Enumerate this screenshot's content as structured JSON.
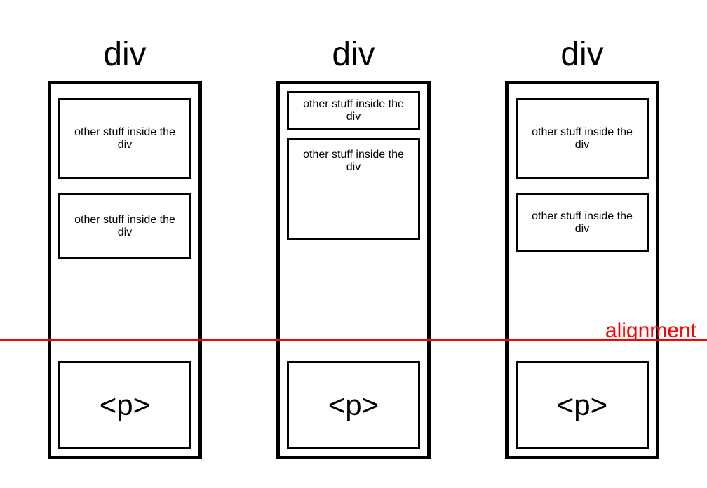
{
  "columns": [
    {
      "label": "div",
      "boxes": [
        {
          "text": "other stuff inside the div"
        },
        {
          "text": "other stuff inside the div"
        }
      ],
      "p_label": "<p>"
    },
    {
      "label": "div",
      "boxes": [
        {
          "text": "other stuff inside the div"
        },
        {
          "text": "other stuff inside the div"
        }
      ],
      "p_label": "<p>"
    },
    {
      "label": "div",
      "boxes": [
        {
          "text": "other stuff inside the div"
        },
        {
          "text": "other stuff inside the div"
        }
      ],
      "p_label": "<p>"
    }
  ],
  "alignment_label": "alignment"
}
